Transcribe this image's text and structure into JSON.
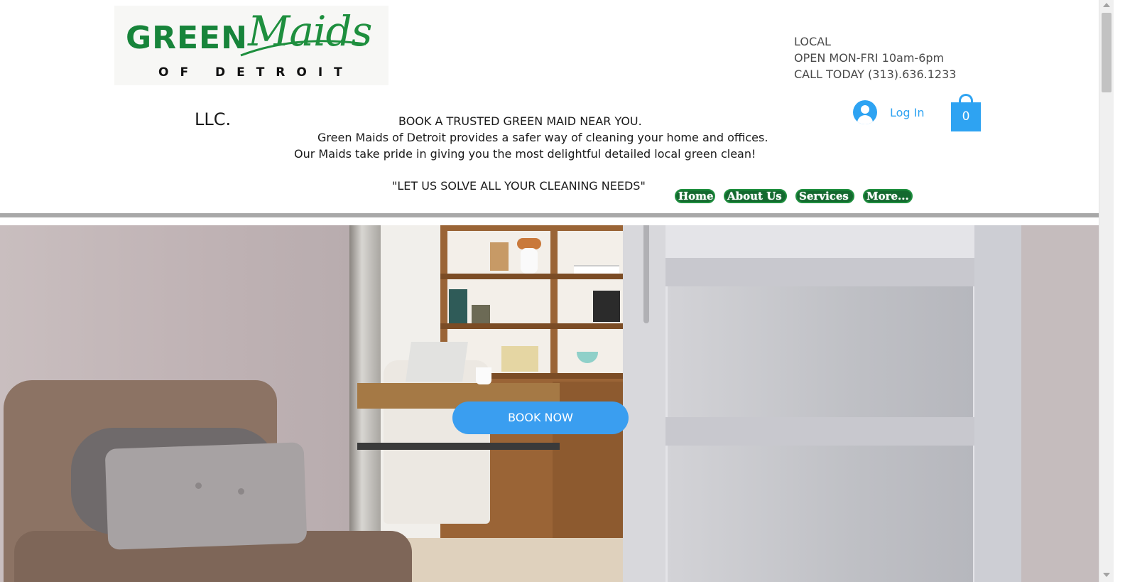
{
  "logo": {
    "green": "GREEN",
    "maids": "Maids",
    "subtitle": "OF DETROIT",
    "llc": "LLC."
  },
  "info": {
    "line1": "LOCAL",
    "line2": "OPEN MON-FRI 10am-6pm",
    "line3": "CALL TODAY (313).636.1233"
  },
  "tagline": {
    "line1": "BOOK A TRUSTED GREEN MAID NEAR YOU.",
    "line2": "Green Maids of Detroit provides a safer way of cleaning your home and offices.",
    "line3": "Our Maids take pride in giving you the most delightful detailed local green clean!",
    "line4": "\"LET US SOLVE ALL YOUR CLEANING NEEDS\""
  },
  "login": {
    "label": "Log In",
    "icon": "user-avatar-icon"
  },
  "cart": {
    "count": "0",
    "icon": "shopping-bag-icon"
  },
  "nav": {
    "items": [
      "Home",
      "About Us",
      "Services",
      "More..."
    ]
  },
  "hero": {
    "cta": "BOOK NOW"
  },
  "colors": {
    "brand_green": "#1e8f3e",
    "nav_green": "#14692f",
    "accent_blue": "#2ea3f2",
    "cta_blue": "#3a9ef0",
    "divider_gray": "#a8a8a8"
  }
}
